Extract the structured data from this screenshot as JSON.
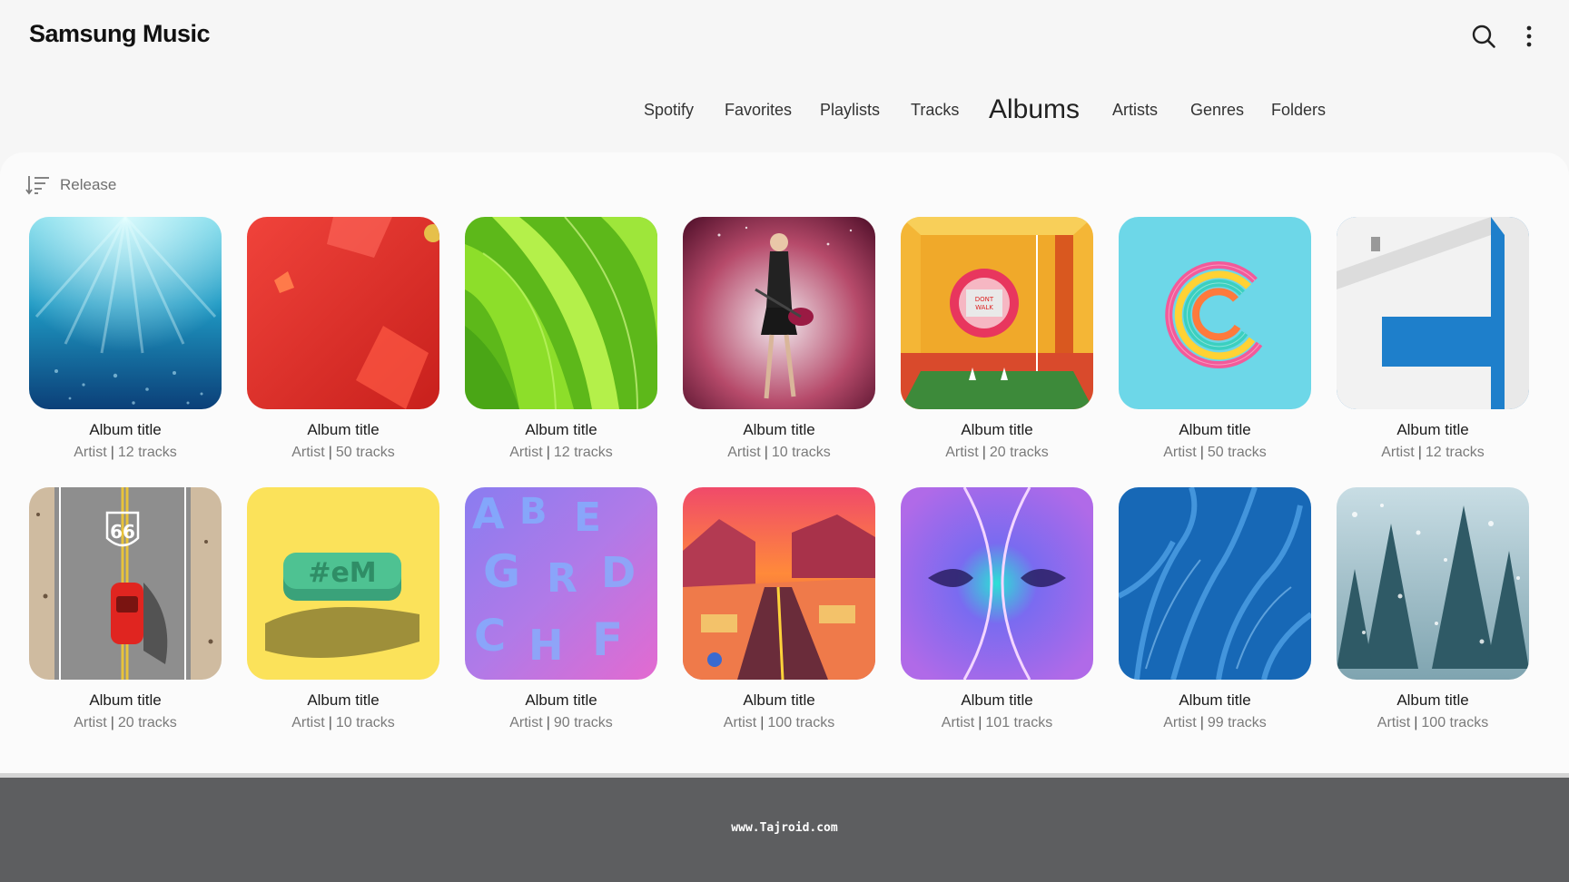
{
  "app": {
    "title": "Samsung Music"
  },
  "toolbar": {
    "search_icon": "search-icon",
    "more_icon": "more-vert-icon"
  },
  "tabs": [
    {
      "label": "Spotify",
      "active": false
    },
    {
      "label": "Favorites",
      "active": false
    },
    {
      "label": "Playlists",
      "active": false
    },
    {
      "label": "Tracks",
      "active": false
    },
    {
      "label": "Albums",
      "active": true
    },
    {
      "label": "Artists",
      "active": false
    },
    {
      "label": "Genres",
      "active": false
    },
    {
      "label": "Folders",
      "active": false
    }
  ],
  "sort": {
    "label": "Release",
    "icon": "sort-icon"
  },
  "albums": [
    {
      "title": "Album title",
      "artist": "Artist",
      "tracks": "12 tracks",
      "art": "underwater-light"
    },
    {
      "title": "Album title",
      "artist": "Artist",
      "tracks": "50 tracks",
      "art": "red-paper"
    },
    {
      "title": "Album title",
      "artist": "Artist",
      "tracks": "12 tracks",
      "art": "green-leaves"
    },
    {
      "title": "Album title",
      "artist": "Artist",
      "tracks": "10 tracks",
      "art": "guitarist-on-stage"
    },
    {
      "title": "Album title",
      "artist": "Artist",
      "tracks": "20 tracks",
      "art": "dont-walk-sign"
    },
    {
      "title": "Album title",
      "artist": "Artist",
      "tracks": "50 tracks",
      "art": "rainbow-spring"
    },
    {
      "title": "Album title",
      "artist": "Artist",
      "tracks": "12 tracks",
      "art": "white-building-moon"
    },
    {
      "title": "Album title",
      "artist": "Artist",
      "tracks": "20 tracks",
      "art": "route-66-car"
    },
    {
      "title": "Album title",
      "artist": "Artist",
      "tracks": "10 tracks",
      "art": "3d-hashtag"
    },
    {
      "title": "Album title",
      "artist": "Artist",
      "tracks": "90 tracks",
      "art": "purple-letters"
    },
    {
      "title": "Album title",
      "artist": "Artist",
      "tracks": "100 tracks",
      "art": "desert-canyon-road"
    },
    {
      "title": "Album title",
      "artist": "Artist",
      "tracks": "101 tracks",
      "art": "purple-vortex"
    },
    {
      "title": "Album title",
      "artist": "Artist",
      "tracks": "99 tracks",
      "art": "blue-frost"
    },
    {
      "title": "Album title",
      "artist": "Artist",
      "tracks": "100 tracks",
      "art": "snowy-pines"
    }
  ],
  "footer": {
    "watermark": "www.Tajroid.com"
  },
  "colors": {
    "background": "#f6f6f6",
    "card": "#fbfbfb",
    "band": "#5d5e60"
  }
}
